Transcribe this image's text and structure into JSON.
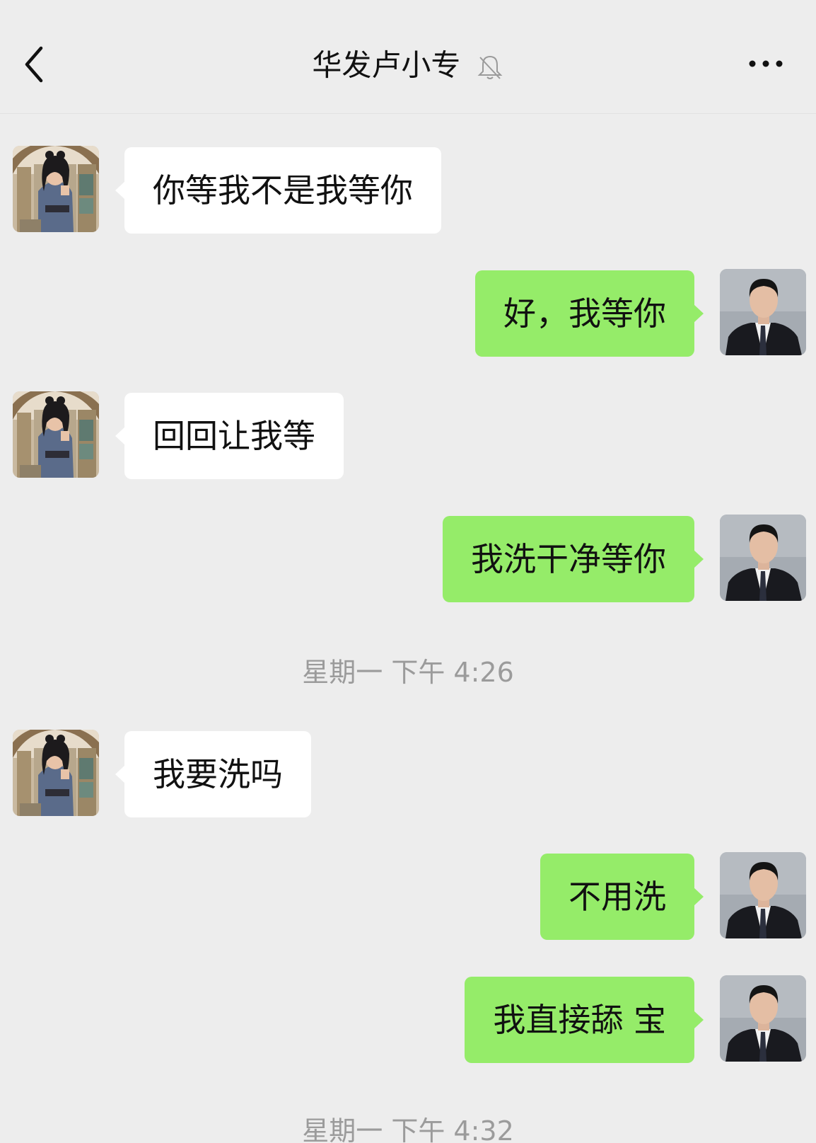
{
  "header": {
    "title": "华发卢小专",
    "back_icon": "chevron-left-icon",
    "mute_icon": "bell-off-icon",
    "more_icon": "more-dots-icon"
  },
  "colors": {
    "background": "#ededed",
    "incoming_bubble": "#ffffff",
    "outgoing_bubble": "#95ec69",
    "timestamp_text": "#9b9b9b"
  },
  "messages": [
    {
      "side": "left",
      "text": "你等我不是我等你"
    },
    {
      "side": "right",
      "text": "好，我等你"
    },
    {
      "side": "left",
      "text": "回回让我等"
    },
    {
      "side": "right",
      "text": "我洗干净等你"
    },
    {
      "side": "left",
      "text": "我要洗吗"
    },
    {
      "side": "right",
      "text": "不用洗"
    },
    {
      "side": "right",
      "text": "我直接舔 宝"
    }
  ],
  "timestamps": [
    {
      "text": "星期一 下午 4:26"
    },
    {
      "text": "星期一 下午 4:32"
    }
  ]
}
